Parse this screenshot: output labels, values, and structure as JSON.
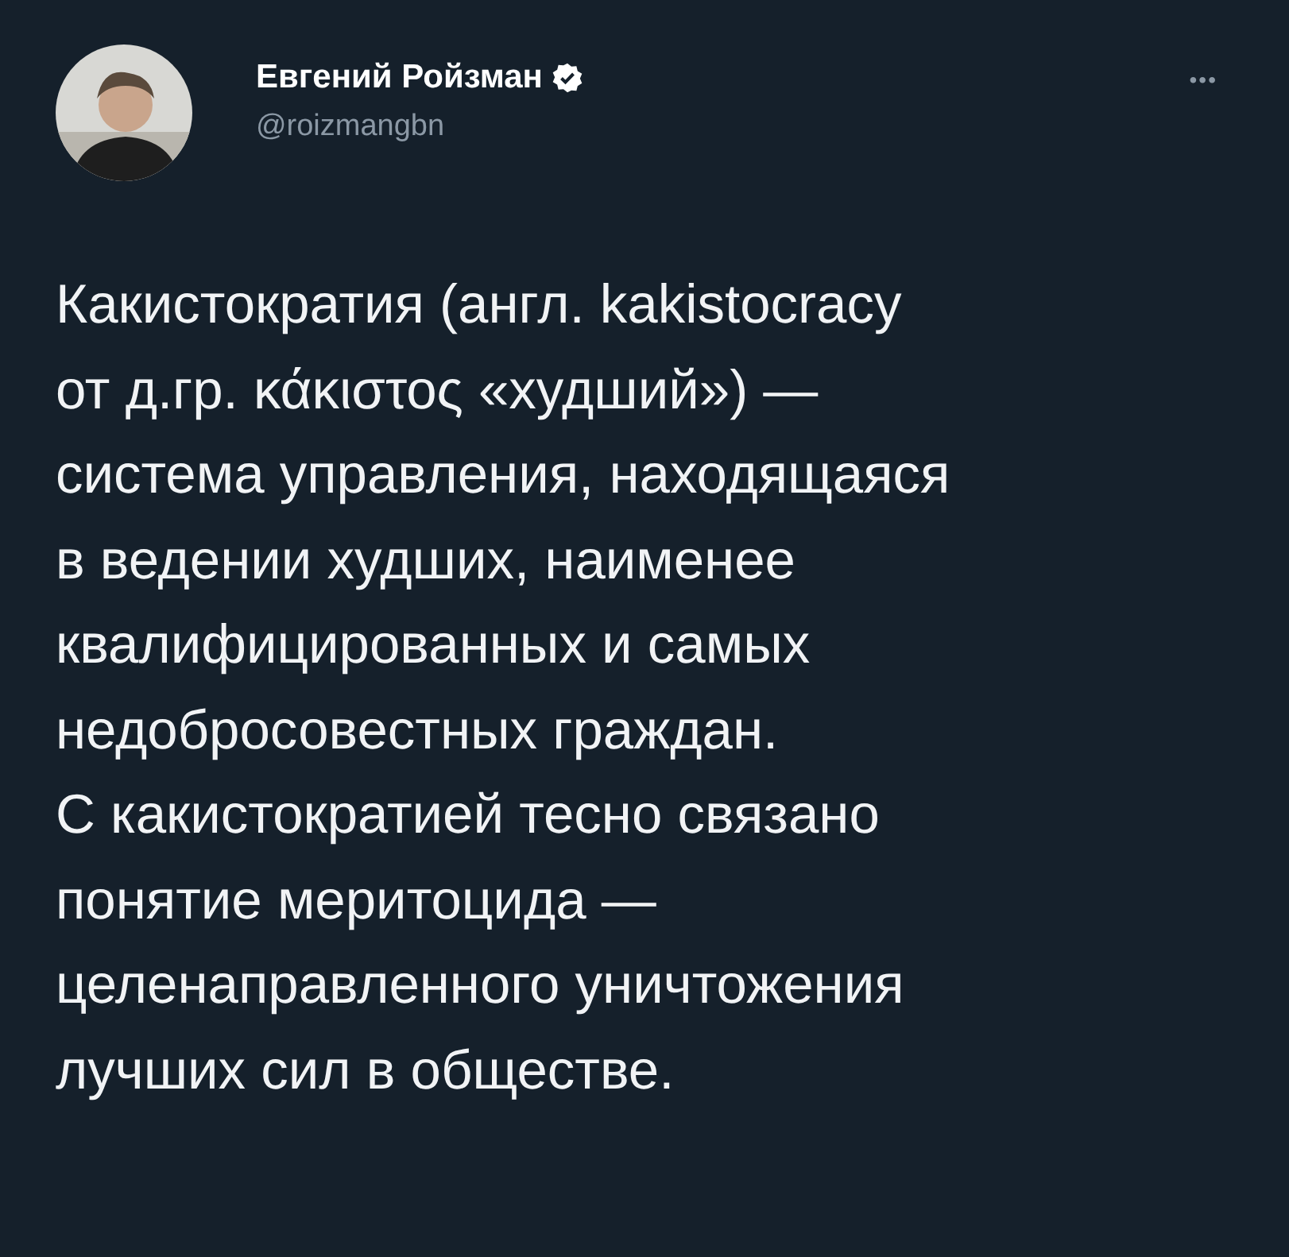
{
  "author": {
    "name": "Евгений Ройзман",
    "verified": true,
    "handle": "@roizmangbn"
  },
  "more": "•••",
  "text_lines": [
    "Какистократия (англ. kakistocracy",
    "от д.гр. κάκιστος «худший») —",
    "система управления, находящаяся",
    "в ведении худших, наименее",
    "квалифицированных и самых",
    "недобросовестных граждан.",
    "С какистократией тесно связано",
    "понятие меритоцида —",
    "целенаправленного уничтожения",
    "лучших сил в обществе."
  ]
}
